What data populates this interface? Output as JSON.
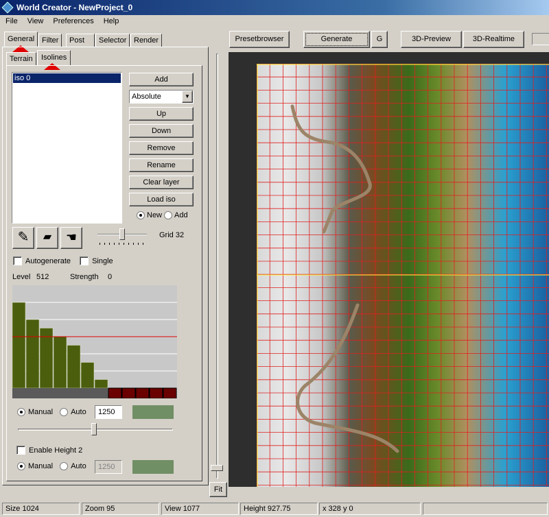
{
  "window": {
    "title": "World Creator -  NewProject_0"
  },
  "menu": [
    "File",
    "View",
    "Preferences",
    "Help"
  ],
  "tabs": [
    "General",
    "Filter",
    "Post",
    "Selector",
    "Render"
  ],
  "subtabs": [
    "Terrain",
    "Isolines"
  ],
  "iso_list": [
    "iso 0"
  ],
  "buttons": {
    "add": "Add",
    "mode": "Absolute",
    "up": "Up",
    "down": "Down",
    "remove": "Remove",
    "rename": "Rename",
    "clear": "Clear layer",
    "load": "Load iso",
    "new": "New",
    "add_radio": "Add"
  },
  "tools": [
    "pencil-icon",
    "eraser-icon",
    "hand-icon"
  ],
  "grid_label": "Grid 32",
  "grid_slider": 0.5,
  "options": {
    "autogenerate": "Autogenerate",
    "single": "Single"
  },
  "level": {
    "label": "Level",
    "value": "512",
    "strength_label": "Strength",
    "strength_value": "0"
  },
  "histogram": {
    "bars": [
      5,
      4,
      3.5,
      3,
      2.5,
      1.5,
      0.5
    ],
    "colors": {
      "bar": "#4b5e0e",
      "line": "#e00000",
      "base": "#5a5a5a",
      "marker": "#6a0000"
    }
  },
  "height1": {
    "manual": "Manual",
    "auto": "Auto",
    "value": "1250",
    "color": "#718f65",
    "slider": 0.49
  },
  "height2": {
    "enable": "Enable Height 2",
    "manual": "Manual",
    "auto": "Auto",
    "value": "1250",
    "color": "#718f65"
  },
  "toolbar": {
    "presetbrowser": "Presetbrowser",
    "generate": "Generate",
    "g": "G",
    "preview": "3D-Preview",
    "realtime": "3D-Realtime",
    "fit": "Fit"
  },
  "status": {
    "size": "Size 1024",
    "zoom": "Zoom  95",
    "view": "View  1077",
    "height": "Height 927.75",
    "coords": "x 328 y 0"
  }
}
